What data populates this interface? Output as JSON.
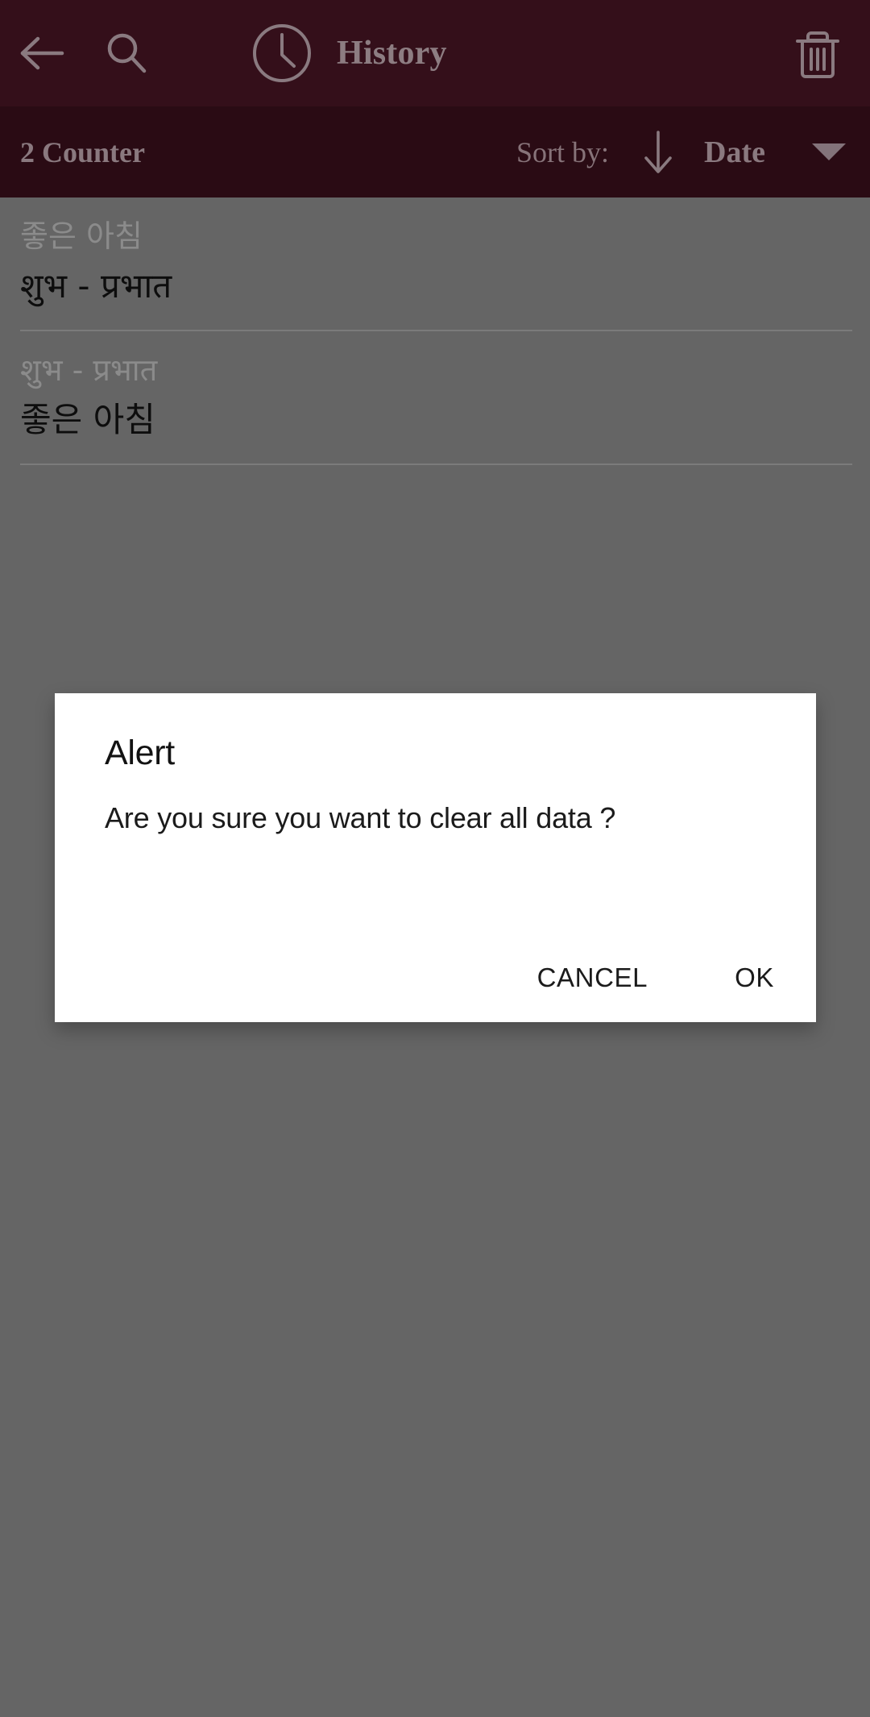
{
  "appbar": {
    "back_icon": "arrow-left-icon",
    "search_icon": "search-icon",
    "clock_icon": "clock-icon",
    "title": "History",
    "delete_icon": "trash-icon",
    "background_color": "#340f1a",
    "foreground_color": "#8d7d82"
  },
  "subbar": {
    "counter_label": "2 Counter",
    "sort_by_label": "Sort by:",
    "sort_direction_icon": "arrow-down-icon",
    "sort_field": "Date",
    "dropdown_icon": "chevron-down-icon",
    "background_color": "#2a0b14"
  },
  "history": {
    "items": [
      {
        "source_text": "좋은 아침",
        "target_text": "शुभ - प्रभात"
      },
      {
        "source_text": "शुभ - प्रभात",
        "target_text": "좋은 아침"
      }
    ]
  },
  "dialog": {
    "title": "Alert",
    "message": "Are you sure you want to clear all data ?",
    "cancel_label": "CANCEL",
    "ok_label": "OK",
    "background_color": "#ffffff"
  },
  "overlay": {
    "color": "#656565"
  }
}
